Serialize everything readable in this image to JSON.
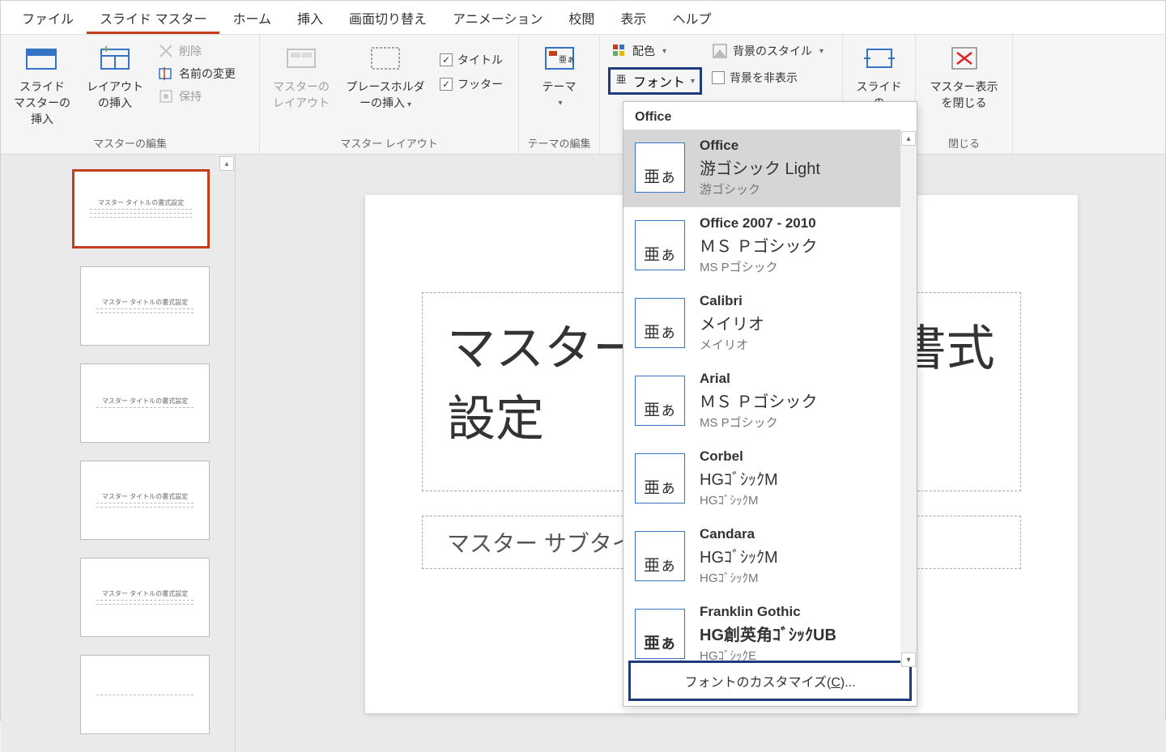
{
  "tabs": {
    "file": "ファイル",
    "slideMaster": "スライド マスター",
    "home": "ホーム",
    "insert": "挿入",
    "transition": "画面切り替え",
    "animation": "アニメーション",
    "review": "校閲",
    "view": "表示",
    "help": "ヘルプ"
  },
  "ribbon": {
    "editMaster": {
      "insertMaster": "スライド マスターの挿入",
      "insertLayout": "レイアウトの挿入",
      "delete": "削除",
      "rename": "名前の変更",
      "preserve": "保持",
      "groupLabel": "マスターの編集"
    },
    "masterLayout": {
      "masterLayoutBtn": "マスターのレイアウト",
      "placeholder": "プレースホルダーの挿入",
      "title": "タイトル",
      "footer": "フッター",
      "groupLabel": "マスター レイアウト"
    },
    "editTheme": {
      "theme": "テーマ",
      "groupLabel": "テーマの編集"
    },
    "background": {
      "colors": "配色",
      "fonts": "フォント",
      "bgStyle": "背景のスタイル",
      "hideBg": "背景を非表示"
    },
    "size": {
      "slideSize": "スライドの"
    },
    "close": {
      "closeMaster": "マスター表示を閉じる",
      "groupLabel": "閉じる"
    }
  },
  "thumbs": {
    "masterTitle": "マスター タイトルの書式設定",
    "layoutTitle": "マスター タイトルの書式設定"
  },
  "slide": {
    "title": "マスター タイトルの書式設定",
    "subtitle": "マスター サブタイトルの書式設定"
  },
  "fontDropdown": {
    "header": "Office",
    "items": [
      {
        "name": "Office",
        "major": "游ゴシック Light",
        "minor": "游ゴシック",
        "sample": "亜ぁ"
      },
      {
        "name": "Office 2007 - 2010",
        "major": "ＭＳ Ｐゴシック",
        "minor": "MS Pゴシック",
        "sample": "亜ぁ"
      },
      {
        "name": "Calibri",
        "major": "メイリオ",
        "minor": "メイリオ",
        "sample": "亜ぁ"
      },
      {
        "name": "Arial",
        "major": "ＭＳ Ｐゴシック",
        "minor": "MS Pゴシック",
        "sample": "亜ぁ"
      },
      {
        "name": "Corbel",
        "major": "HGｺﾞｼｯｸM",
        "minor": "HGｺﾞｼｯｸM",
        "sample": "亜ぁ"
      },
      {
        "name": "Candara",
        "major": "HGｺﾞｼｯｸM",
        "minor": "HGｺﾞｼｯｸM",
        "sample": "亜ぁ"
      },
      {
        "name": "Franklin Gothic",
        "major": "HG創英角ｺﾞｼｯｸUB",
        "minor": "HGｺﾞｼｯｸE",
        "sample": "亜ぁ"
      }
    ],
    "customizePrefix": "フォントのカスタマイズ(",
    "customizeKey": "C",
    "customizeSuffix": ")..."
  }
}
